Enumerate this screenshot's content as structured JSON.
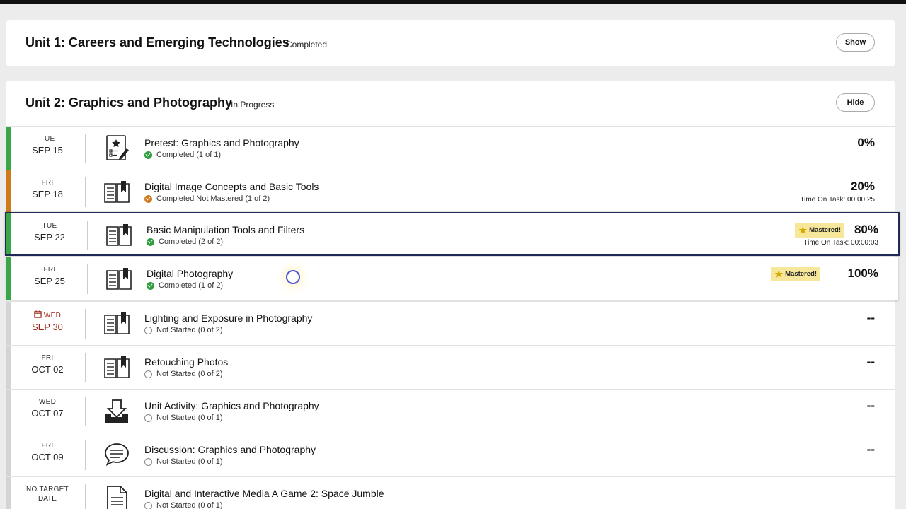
{
  "units": [
    {
      "title": "Unit 1: Careers and Emerging Technologies",
      "status": "Completed",
      "toggle_label": "Show"
    },
    {
      "title": "Unit 2: Graphics and Photography",
      "status": "In Progress",
      "toggle_label": "Hide"
    }
  ],
  "activities": [
    {
      "dow": "TUE",
      "date": "SEP 15",
      "icon": "pretest-icon",
      "title": "Pretest: Graphics and Photography",
      "status": "Completed (1 of 1)",
      "status_type": "completed",
      "score": "0%",
      "time_on_task": "",
      "mastered": "",
      "bar_color": "#3aa64a"
    },
    {
      "dow": "FRI",
      "date": "SEP 18",
      "icon": "book-icon",
      "title": "Digital Image Concepts and Basic Tools",
      "status": "Completed Not Mastered (1 of 2)",
      "status_type": "not-mastered",
      "score": "20%",
      "time_on_task": "Time On Task: 00:00:25",
      "mastered": "",
      "bar_color": "#d07a1e"
    },
    {
      "dow": "TUE",
      "date": "SEP 22",
      "icon": "book-icon",
      "title": "Basic Manipulation Tools and Filters",
      "status": "Completed (2 of 2)",
      "status_type": "completed",
      "score": "80%",
      "time_on_task": "Time On Task: 00:00:03",
      "mastered": "Mastered!",
      "bar_color": "#3aa64a"
    },
    {
      "dow": "FRI",
      "date": "SEP 25",
      "icon": "book-icon",
      "title": "Digital Photography",
      "status": "Completed (1 of 2)",
      "status_type": "completed",
      "score": "100%",
      "time_on_task": "",
      "mastered": "Mastered!",
      "bar_color": "#3aa64a"
    },
    {
      "dow": "WED",
      "date": "SEP 30",
      "icon": "book-icon",
      "title": "Lighting and Exposure in Photography",
      "status": "Not Started (0 of 2)",
      "status_type": "not-started",
      "score": "--",
      "time_on_task": "",
      "mastered": "",
      "bar_color": "#d4d4d4",
      "due": true
    },
    {
      "dow": "FRI",
      "date": "OCT 02",
      "icon": "book-icon",
      "title": "Retouching Photos",
      "status": "Not Started (0 of 2)",
      "status_type": "not-started",
      "score": "--",
      "time_on_task": "",
      "mastered": "",
      "bar_color": "#d4d4d4"
    },
    {
      "dow": "WED",
      "date": "OCT 07",
      "icon": "download-icon",
      "title": "Unit Activity: Graphics and Photography",
      "status": "Not Started (0 of 1)",
      "status_type": "not-started",
      "score": "--",
      "time_on_task": "",
      "mastered": "",
      "bar_color": "#d4d4d4"
    },
    {
      "dow": "FRI",
      "date": "OCT 09",
      "icon": "discussion-icon",
      "title": "Discussion: Graphics and Photography",
      "status": "Not Started (0 of 1)",
      "status_type": "not-started",
      "score": "--",
      "time_on_task": "",
      "mastered": "",
      "bar_color": "#d4d4d4"
    },
    {
      "dow": "NO TARGET",
      "date": "DATE",
      "icon": "document-icon",
      "title": "Digital and Interactive Media A Game 2: Space Jumble",
      "status": "Not Started (0 of 1)",
      "status_type": "not-started",
      "score": "",
      "time_on_task": "",
      "mastered": "",
      "bar_color": "#d4d4d4",
      "no_target": true
    }
  ]
}
